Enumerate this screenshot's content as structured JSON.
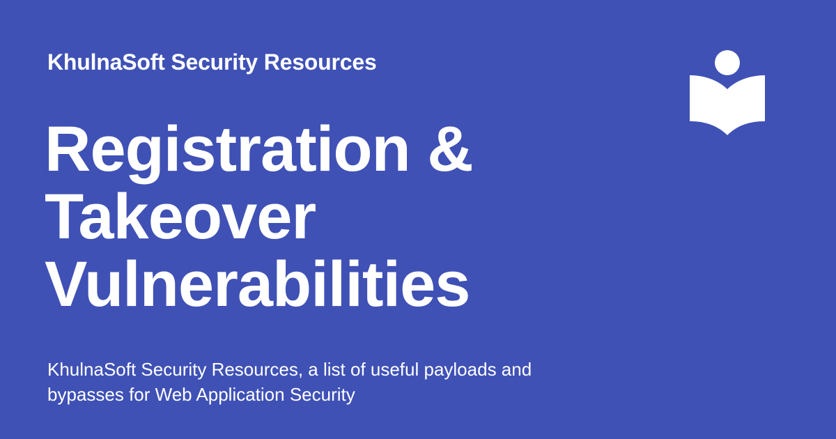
{
  "brand": {
    "accent": "#3f51b5",
    "text_color": "#ffffff",
    "logo_icon": "open-book-reader-icon"
  },
  "site_name": "KhulnaSoft Security Resources",
  "title_lines": [
    "Registration &",
    "Takeover",
    "Vulnerabilities"
  ],
  "description_lines": [
    "KhulnaSoft Security Resources, a list of useful payloads and",
    "bypasses for Web Application Security"
  ]
}
